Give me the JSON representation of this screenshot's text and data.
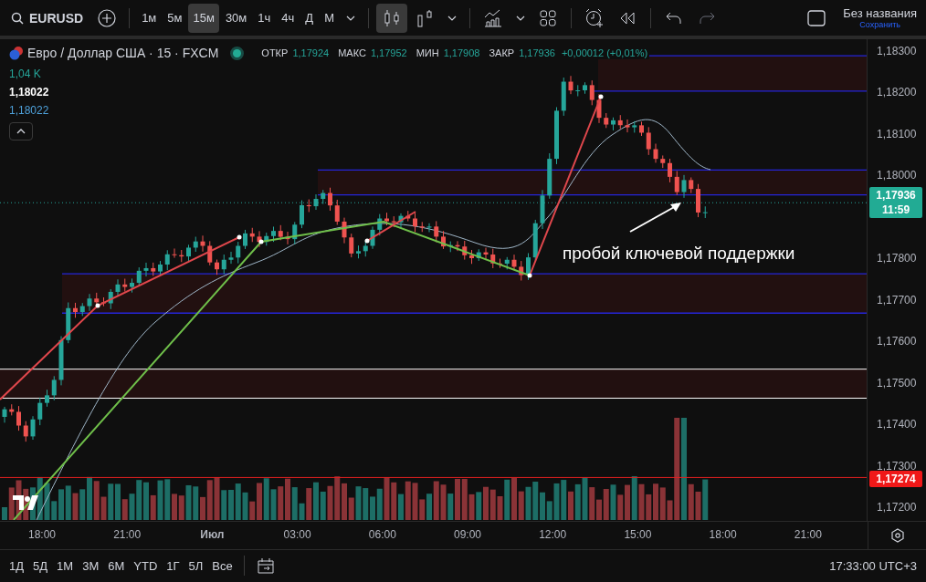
{
  "toolbar": {
    "symbol": "EURUSD",
    "intervals": [
      {
        "label": "1м",
        "selected": false
      },
      {
        "label": "5м",
        "selected": false
      },
      {
        "label": "15м",
        "selected": true
      },
      {
        "label": "30м",
        "selected": false
      },
      {
        "label": "1ч",
        "selected": false
      },
      {
        "label": "4ч",
        "selected": false
      },
      {
        "label": "Д",
        "selected": false
      },
      {
        "label": "М",
        "selected": false
      }
    ],
    "chart_styles": [
      {
        "kind": "candles",
        "selected": true
      },
      {
        "kind": "bars",
        "selected": false
      }
    ],
    "chart_title": "Без названия",
    "save_link": "Сохранить"
  },
  "legend": {
    "title": "Евро / Доллар США · 15 · FXCM",
    "ohlc": [
      {
        "label": "ОТКР",
        "value": "1,17924"
      },
      {
        "label": "МАКС",
        "value": "1,17952"
      },
      {
        "label": "МИН",
        "value": "1,17908"
      },
      {
        "label": "ЗАКР",
        "value": "1,17936"
      }
    ],
    "change": "+0,00012 (+0,01%)",
    "volume": "1,04 K",
    "value_1": "1,18022",
    "value_2": "1,18022"
  },
  "annotation": "пробой ключевой поддержки",
  "price_axis": {
    "upper_ticks": [
      "1,18300",
      "1,18200",
      "1,18100",
      "1,18000"
    ],
    "lower_ticks": [
      "1,17800",
      "1,17700",
      "1,17600",
      "1,17500",
      "1,17400",
      "1,17300",
      "1,17200"
    ],
    "current_price": "1,17936",
    "countdown": "11:59",
    "line_label": "1,17274"
  },
  "time_axis": {
    "ticks": [
      "18:00",
      "21:00",
      "Июл",
      "03:00",
      "06:00",
      "09:00",
      "12:00",
      "15:00",
      "18:00",
      "21:00"
    ]
  },
  "range_bar": {
    "ranges": [
      "1Д",
      "5Д",
      "1М",
      "3М",
      "6М",
      "YTD",
      "1Г",
      "5Л",
      "Все"
    ],
    "clock": "17:33:00 UTC+3"
  }
}
